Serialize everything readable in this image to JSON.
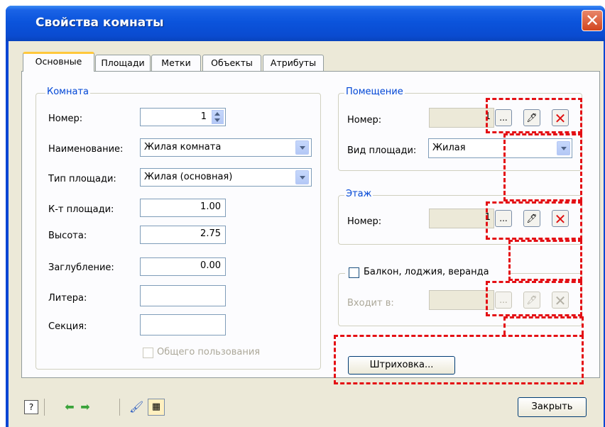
{
  "window": {
    "title": "Свойства комнаты",
    "close_icon": "close-icon"
  },
  "tabs": [
    {
      "label": "Основные",
      "active": true
    },
    {
      "label": "Площади"
    },
    {
      "label": "Метки"
    },
    {
      "label": "Объекты"
    },
    {
      "label": "Атрибуты"
    }
  ],
  "room": {
    "legend": "Комната",
    "number_label": "Номер:",
    "number_value": "1",
    "name_label": "Наименование:",
    "name_value": "Жилая комната",
    "area_type_label": "Тип площади:",
    "area_type_value": "Жилая (основная)",
    "area_coef_label": "К-т площади:",
    "area_coef_value": "1.00",
    "height_label": "Высота:",
    "height_value": "2.75",
    "depth_label": "Заглубление:",
    "depth_value": "0.00",
    "letter_label": "Литера:",
    "letter_value": "",
    "section_label": "Секция:",
    "section_value": "",
    "shared_label": "Общего пользования"
  },
  "premises": {
    "legend": "Помещение",
    "number_label": "Номер:",
    "number_value": "1",
    "area_kind_label": "Вид площади:",
    "area_kind_value": "Жилая"
  },
  "floor": {
    "legend": "Этаж",
    "number_label": "Номер:",
    "number_value": "1"
  },
  "balcony": {
    "checkbox_label": "Балкон, лоджия, веранда",
    "part_of_label": "Входит в:"
  },
  "buttons": {
    "browse": "...",
    "hatch": "Штриховка...",
    "close": "Закрыть"
  },
  "colors": {
    "highlight_dash": "#e40f14",
    "title_bar": "#0a4bd0",
    "legend_text": "#0046d5"
  },
  "toolbar_icons": [
    "help-icon",
    "arrow-left-icon",
    "arrow-right-icon",
    "brush-icon",
    "grid-icon"
  ]
}
